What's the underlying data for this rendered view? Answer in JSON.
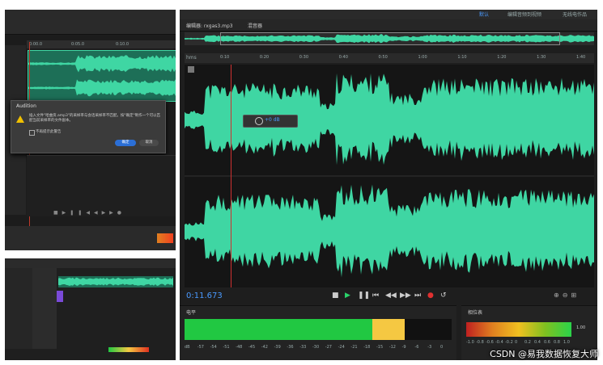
{
  "colors": {
    "wave": "#3fd6a3",
    "bg": "#232323",
    "accent": "#2b6fd6",
    "meter_green": "#21c842",
    "meter_yellow": "#f5c842"
  },
  "left_top": {
    "ruler_ticks": [
      "0:00.0",
      "0:05.0",
      "0:10.0"
    ],
    "dialog": {
      "title": "Audition",
      "message": "插入文件\"哈曲资.amp3\"的采样率与会话采样率不匹配。按\"确定\"制作一个可以匹配当前采样率的文件副本。",
      "checkbox_label": "不再提示此警告",
      "ok_label": "确定",
      "cancel_label": "取消"
    }
  },
  "main": {
    "workspace_tabs": [
      "默认",
      "编辑音频到视频",
      "无线电作品"
    ],
    "editor_tab": "编辑器: rxgas3.mp3",
    "mixer_tab": "混音器",
    "ruler_unit": "hms",
    "ruler_ticks": [
      "0:10",
      "0:20",
      "0:30",
      "0:40",
      "0:50",
      "1:00",
      "1:10",
      "1:20",
      "1:30",
      "1:40"
    ],
    "hud_value": "+0 dB",
    "time_display": "0:11.673",
    "level_panel_label": "电平",
    "level_scale": [
      "dB",
      "-57",
      "-54",
      "-51",
      "-48",
      "-45",
      "-42",
      "-39",
      "-36",
      "-33",
      "-30",
      "-27",
      "-24",
      "-21",
      "-18",
      "-15",
      "-12",
      "-9",
      "-6",
      "-3",
      "0"
    ],
    "phase_panel_label": "相位表",
    "phase_value": "1.00",
    "phase_scale": [
      "-1.0",
      "-0.8",
      "-0.6",
      "-0.4",
      "-0.2",
      "0",
      "0.2",
      "0.4",
      "0.6",
      "0.8",
      "1.0"
    ]
  },
  "watermark": "CSDN @易我数据恢复大师"
}
